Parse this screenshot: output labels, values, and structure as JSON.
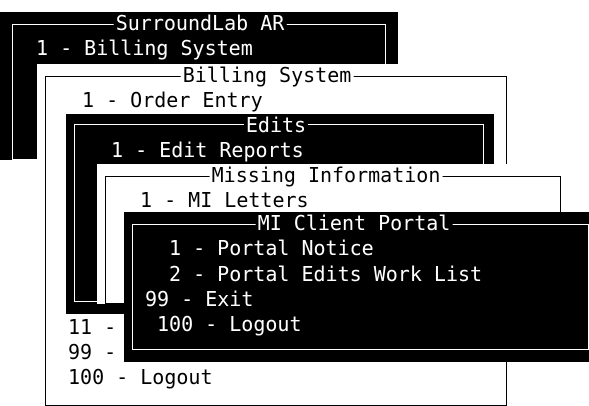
{
  "windows": {
    "surroundlab": {
      "title": "SurroundLab AR",
      "items": [
        "1 - Billing System"
      ]
    },
    "billing": {
      "title": "Billing System",
      "items": [
        "1 - Order Entry",
        "11 -",
        "99 -",
        "100 - Logout"
      ]
    },
    "edits": {
      "title": "Edits",
      "items": [
        "1 - Edit Reports"
      ]
    },
    "missing": {
      "title": "Missing Information",
      "items": [
        "1 - MI Letters"
      ]
    },
    "portal": {
      "title": "MI Client Portal",
      "items": [
        "1 - Portal Notice",
        "2 - Portal Edits Work List",
        "99 - Exit",
        "100 - Logout"
      ]
    }
  }
}
